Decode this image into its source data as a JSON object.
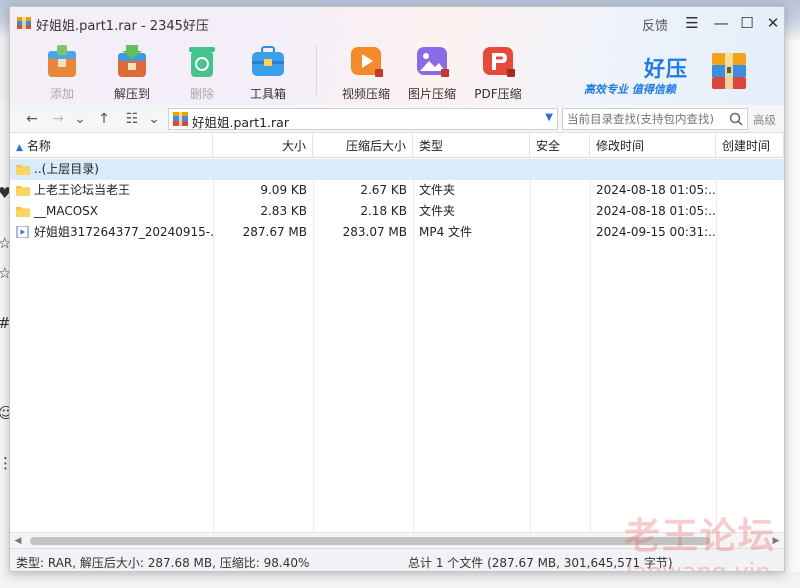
{
  "window": {
    "title": "好姐姐.part1.rar - 2345好压",
    "feedback": "反馈",
    "controls": {
      "settings": "☰",
      "minimize": "—",
      "maximize": "☐",
      "close": "✕"
    }
  },
  "toolbar": {
    "items": [
      {
        "label": "添加",
        "enabled": false,
        "icon": "add-archive-icon"
      },
      {
        "label": "解压到",
        "enabled": true,
        "icon": "extract-icon"
      },
      {
        "label": "删除",
        "enabled": false,
        "icon": "recycle-icon"
      },
      {
        "label": "工具箱",
        "enabled": true,
        "icon": "toolbox-icon"
      },
      {
        "label": "视频压缩",
        "enabled": true,
        "icon": "video-compress-icon"
      },
      {
        "label": "图片压缩",
        "enabled": true,
        "icon": "image-compress-icon"
      },
      {
        "label": "PDF压缩",
        "enabled": true,
        "icon": "pdf-compress-icon"
      }
    ]
  },
  "brand": {
    "name": "好压",
    "slogan": "高效专业  值得信赖",
    "color": "#1e7be6"
  },
  "address": {
    "path": "好姐姐.part1.rar",
    "search_placeholder": "当前目录查找(支持包内查找)",
    "advanced": "高级"
  },
  "table": {
    "columns": [
      "名称",
      "大小",
      "压缩后大小",
      "类型",
      "安全",
      "修改时间",
      "创建时间"
    ],
    "rows": [
      {
        "name": "..(上层目录)",
        "size": "",
        "packed": "",
        "type": "",
        "security": "",
        "modified": "",
        "created": "",
        "icon": "folder-icon",
        "selected": true
      },
      {
        "name": "上老王论坛当老王",
        "size": "9.09 KB",
        "packed": "2.67 KB",
        "type": "文件夹",
        "security": "",
        "modified": "2024-08-18 01:05:...",
        "created": "",
        "icon": "folder-icon",
        "selected": false
      },
      {
        "name": "__MACOSX",
        "size": "2.83 KB",
        "packed": "2.18 KB",
        "type": "文件夹",
        "security": "",
        "modified": "2024-08-18 01:05:...",
        "created": "",
        "icon": "folder-icon",
        "selected": false
      },
      {
        "name": "好姐姐317264377_20240915-...",
        "size": "287.67 MB",
        "packed": "283.07 MB",
        "type": "MP4 文件",
        "security": "",
        "modified": "2024-09-15 00:31:...",
        "created": "",
        "icon": "video-file-icon",
        "selected": false
      }
    ]
  },
  "status": {
    "left": "类型: RAR, 解压后大小: 287.68 MB, 压缩比: 98.40%",
    "right": "总计 1 个文件 (287.67 MB, 301,645,571 字节)"
  },
  "watermark": {
    "line1": "老王论坛",
    "line2": "laowang.vip"
  }
}
